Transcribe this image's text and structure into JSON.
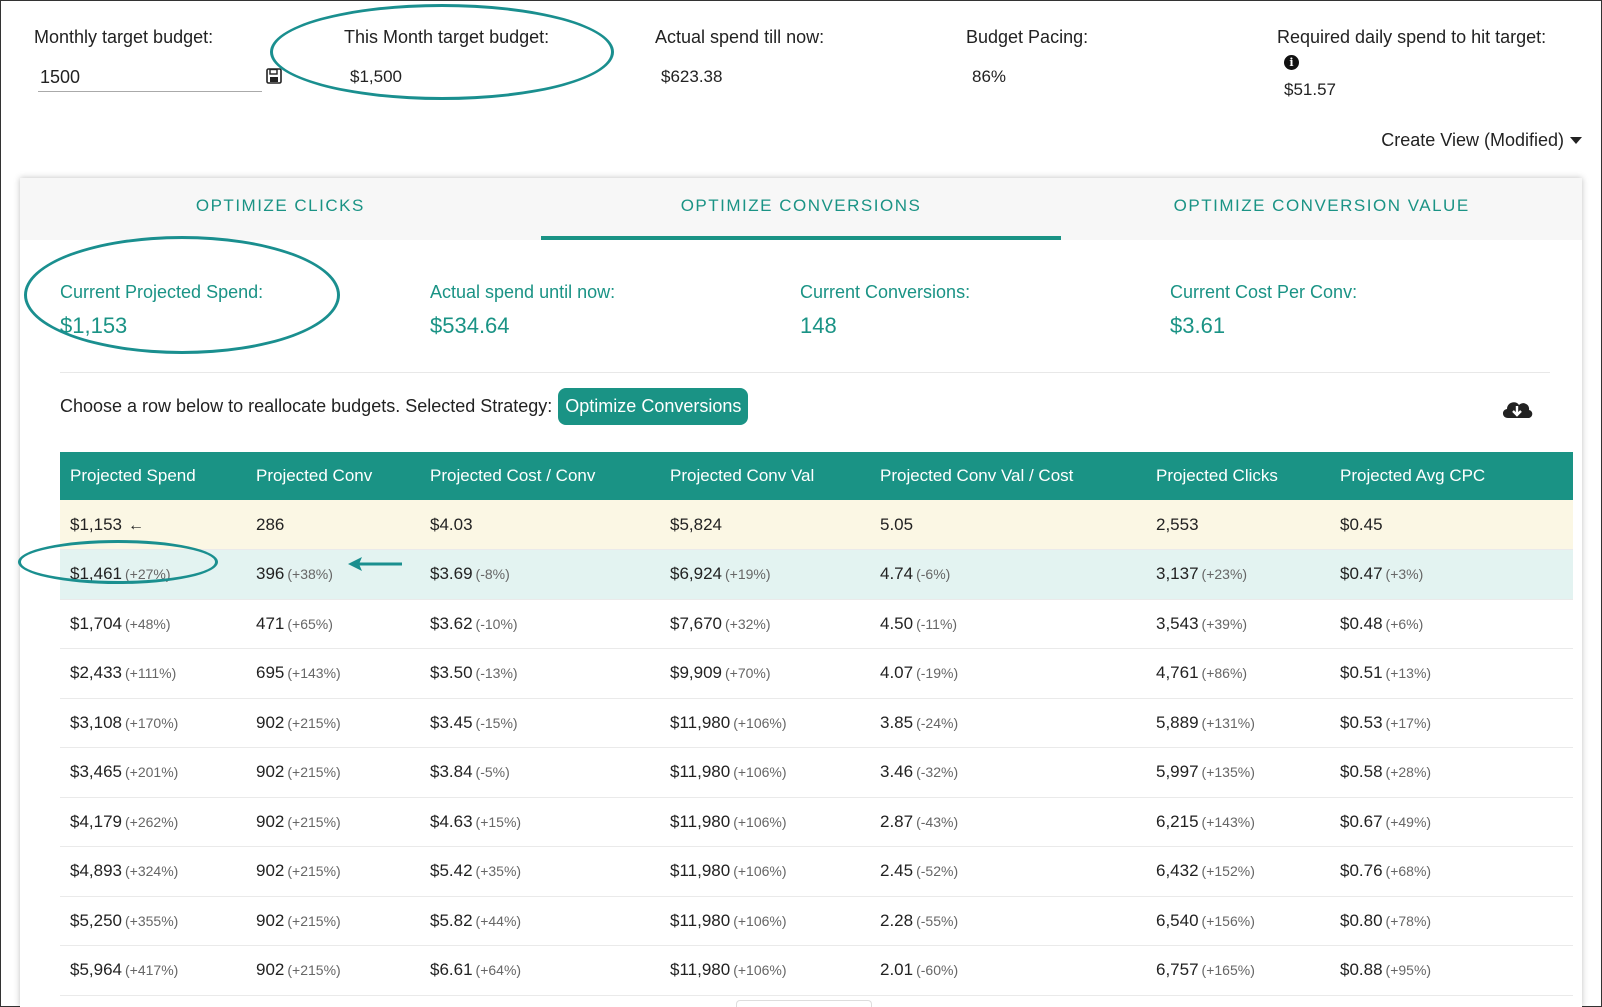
{
  "top": {
    "monthly_label": "Monthly target budget:",
    "monthly_value": "1500",
    "this_month_label": "This Month target budget:",
    "this_month_value": "$1,500",
    "actual_label": "Actual spend till now:",
    "actual_value": "$623.38",
    "pacing_label": "Budget Pacing:",
    "pacing_value": "86%",
    "required_label": "Required daily spend to hit target:",
    "required_value": "$51.57",
    "create_view": "Create View (Modified)"
  },
  "tabs": [
    {
      "label": "OPTIMIZE CLICKS",
      "active": false
    },
    {
      "label": "OPTIMIZE CONVERSIONS",
      "active": true
    },
    {
      "label": "OPTIMIZE CONVERSION VALUE",
      "active": false
    }
  ],
  "kpis": [
    {
      "label": "Current Projected Spend:",
      "value": "$1,153"
    },
    {
      "label": "Actual spend until now:",
      "value": "$534.64"
    },
    {
      "label": "Current Conversions:",
      "value": "148"
    },
    {
      "label": "Current Cost Per Conv:",
      "value": "$3.61"
    }
  ],
  "strategy": {
    "prompt": "Choose a row below to reallocate budgets. Selected Strategy:",
    "selected": "Optimize Conversions"
  },
  "table": {
    "headers": [
      "Projected Spend",
      "Projected Conv",
      "Projected Cost / Conv",
      "Projected Conv Val",
      "Projected Conv Val / Cost",
      "Projected Clicks",
      "Projected Avg CPC"
    ],
    "rows": [
      [
        [
          "$1,153",
          ""
        ],
        [
          "286",
          ""
        ],
        [
          "$4.03",
          ""
        ],
        [
          "$5,824",
          ""
        ],
        [
          "5.05",
          ""
        ],
        [
          "2,553",
          ""
        ],
        [
          "$0.45",
          ""
        ]
      ],
      [
        [
          "$1,461",
          "(+27%)"
        ],
        [
          "396",
          "(+38%)"
        ],
        [
          "$3.69",
          "(-8%)"
        ],
        [
          "$6,924",
          "(+19%)"
        ],
        [
          "4.74",
          "(-6%)"
        ],
        [
          "3,137",
          "(+23%)"
        ],
        [
          "$0.47",
          "(+3%)"
        ]
      ],
      [
        [
          "$1,704",
          "(+48%)"
        ],
        [
          "471",
          "(+65%)"
        ],
        [
          "$3.62",
          "(-10%)"
        ],
        [
          "$7,670",
          "(+32%)"
        ],
        [
          "4.50",
          "(-11%)"
        ],
        [
          "3,543",
          "(+39%)"
        ],
        [
          "$0.48",
          "(+6%)"
        ]
      ],
      [
        [
          "$2,433",
          "(+111%)"
        ],
        [
          "695",
          "(+143%)"
        ],
        [
          "$3.50",
          "(-13%)"
        ],
        [
          "$9,909",
          "(+70%)"
        ],
        [
          "4.07",
          "(-19%)"
        ],
        [
          "4,761",
          "(+86%)"
        ],
        [
          "$0.51",
          "(+13%)"
        ]
      ],
      [
        [
          "$3,108",
          "(+170%)"
        ],
        [
          "902",
          "(+215%)"
        ],
        [
          "$3.45",
          "(-15%)"
        ],
        [
          "$11,980",
          "(+106%)"
        ],
        [
          "3.85",
          "(-24%)"
        ],
        [
          "5,889",
          "(+131%)"
        ],
        [
          "$0.53",
          "(+17%)"
        ]
      ],
      [
        [
          "$3,465",
          "(+201%)"
        ],
        [
          "902",
          "(+215%)"
        ],
        [
          "$3.84",
          "(-5%)"
        ],
        [
          "$11,980",
          "(+106%)"
        ],
        [
          "3.46",
          "(-32%)"
        ],
        [
          "5,997",
          "(+135%)"
        ],
        [
          "$0.58",
          "(+28%)"
        ]
      ],
      [
        [
          "$4,179",
          "(+262%)"
        ],
        [
          "902",
          "(+215%)"
        ],
        [
          "$4.63",
          "(+15%)"
        ],
        [
          "$11,980",
          "(+106%)"
        ],
        [
          "2.87",
          "(-43%)"
        ],
        [
          "6,215",
          "(+143%)"
        ],
        [
          "$0.67",
          "(+49%)"
        ]
      ],
      [
        [
          "$4,893",
          "(+324%)"
        ],
        [
          "902",
          "(+215%)"
        ],
        [
          "$5.42",
          "(+35%)"
        ],
        [
          "$11,980",
          "(+106%)"
        ],
        [
          "2.45",
          "(-52%)"
        ],
        [
          "6,432",
          "(+152%)"
        ],
        [
          "$0.76",
          "(+68%)"
        ]
      ],
      [
        [
          "$5,250",
          "(+355%)"
        ],
        [
          "902",
          "(+215%)"
        ],
        [
          "$5.82",
          "(+44%)"
        ],
        [
          "$11,980",
          "(+106%)"
        ],
        [
          "2.28",
          "(-55%)"
        ],
        [
          "6,540",
          "(+156%)"
        ],
        [
          "$0.80",
          "(+78%)"
        ]
      ],
      [
        [
          "$5,964",
          "(+417%)"
        ],
        [
          "902",
          "(+215%)"
        ],
        [
          "$6.61",
          "(+64%)"
        ],
        [
          "$11,980",
          "(+106%)"
        ],
        [
          "2.01",
          "(-60%)"
        ],
        [
          "6,757",
          "(+165%)"
        ],
        [
          "$0.88",
          "(+95%)"
        ]
      ]
    ],
    "current_row": 0,
    "selected_row": 1
  },
  "icons": {
    "save": "floppy-disk-icon",
    "info": "info-icon",
    "download": "cloud-download-icon",
    "current_marker": "arrow-left-icon",
    "dropdown": "caret-down-icon"
  },
  "colors": {
    "accent": "#1a9385",
    "current_row": "#fbf7e4",
    "selected_row": "#e3f3f1"
  }
}
